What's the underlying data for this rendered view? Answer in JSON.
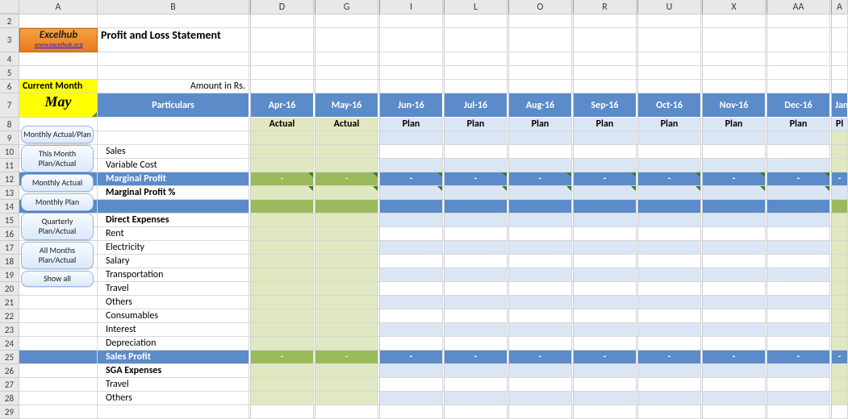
{
  "col_headers": [
    "A",
    "B",
    "D",
    "G",
    "I",
    "L",
    "O",
    "R",
    "U",
    "X",
    "AA"
  ],
  "col_classes": [
    "cA",
    "cB",
    "cDat",
    "cDat",
    "cDat",
    "cDat",
    "cDat",
    "cDat",
    "cDat",
    "cDat",
    "cDat"
  ],
  "row_headers": [
    "2",
    "3",
    "4",
    "5",
    "6",
    "7",
    "8",
    "9",
    "10",
    "11",
    "12",
    "13",
    "14",
    "15",
    "16",
    "17",
    "18",
    "19",
    "20",
    "21",
    "22",
    "23",
    "24",
    "25",
    "26",
    "27",
    "28",
    "29"
  ],
  "logo": {
    "name": "Excelhub",
    "url": "www.excelhub.org"
  },
  "title": "Profit and Loss Statement",
  "cur_month_label": "Current Month",
  "cur_month_value": "May",
  "amount_label": "Amount in Rs.",
  "particulars_header": "Particulars",
  "month_cols": [
    "Apr-16",
    "May-16",
    "Jun-16",
    "Jul-16",
    "Aug-16",
    "Sep-16",
    "Oct-16",
    "Nov-16",
    "Dec-16"
  ],
  "last_col_frag": "Jan",
  "plan_actual": [
    "Actual",
    "Actual",
    "Plan",
    "Plan",
    "Plan",
    "Plan",
    "Plan",
    "Plan",
    "Plan"
  ],
  "last_pa_frag": "Pl",
  "rows": {
    "sales": "Sales",
    "varcost": "Variable Cost",
    "mprofit": "Marginal Profit",
    "mprofitpct": "Marginal Profit %",
    "dexp": "Direct Expenses",
    "rent": "Rent",
    "elec": "Electricity",
    "salary": "Salary",
    "transp": "Transportation",
    "travel": "Travel",
    "others": "Others",
    "consum": "Consumables",
    "interest": "Interest",
    "deprec": "Depreciation",
    "sprofit": "Sales Profit",
    "sga": "SGA Expenses",
    "travel2": "Travel",
    "others2": "Others"
  },
  "dash": "-",
  "buttons": [
    "Monthly Actual/Plan",
    "This Month Plan/Actual",
    "Monthly Actual",
    "Monthly Plan",
    "Quarterly Plan/Actual",
    "All Months Plan/Actual",
    "Show all"
  ]
}
